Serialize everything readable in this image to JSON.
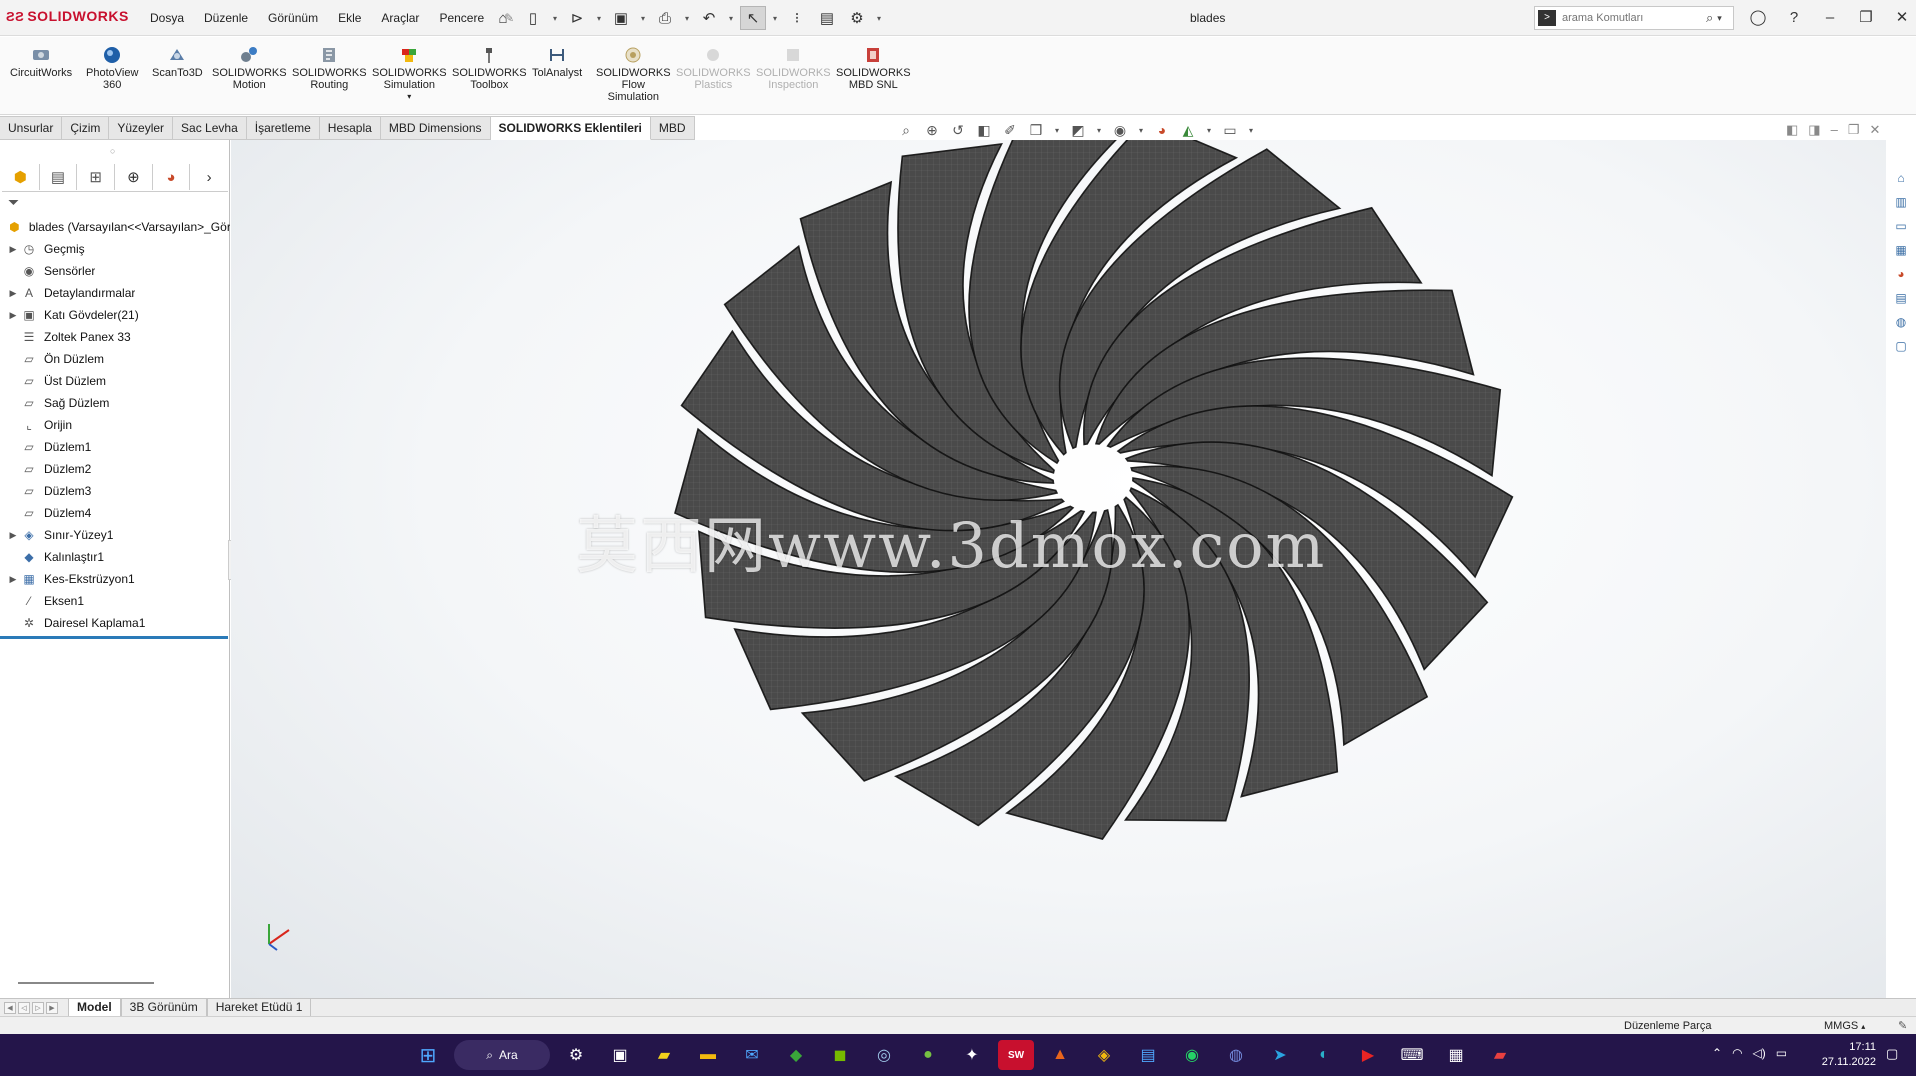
{
  "app": {
    "logo_text": "SOLIDWORKS",
    "doc_title": "blades"
  },
  "menu": [
    "Dosya",
    "Düzenle",
    "Görünüm",
    "Ekle",
    "Araçlar",
    "Pencere"
  ],
  "search": {
    "placeholder": "arama Komutları"
  },
  "ribbon": [
    {
      "label": "CircuitWorks",
      "icon": "circuitworks-icon",
      "disabled": false
    },
    {
      "label": "PhotoView\n360",
      "icon": "photoview-icon",
      "disabled": false
    },
    {
      "label": "ScanTo3D",
      "icon": "scanto3d-icon",
      "disabled": false
    },
    {
      "label": "SOLIDWORKS\nMotion",
      "icon": "motion-icon",
      "disabled": false
    },
    {
      "label": "SOLIDWORKS\nRouting",
      "icon": "routing-icon",
      "disabled": false
    },
    {
      "label": "SOLIDWORKS\nSimulation",
      "icon": "simulation-icon",
      "disabled": false
    },
    {
      "label": "SOLIDWORKS\nToolbox",
      "icon": "toolbox-icon",
      "disabled": false
    },
    {
      "label": "TolAnalyst",
      "icon": "tolanalyst-icon",
      "disabled": false
    },
    {
      "label": "SOLIDWORKS\nFlow\nSimulation",
      "icon": "flow-simulation-icon",
      "disabled": false
    },
    {
      "label": "SOLIDWORKS\nPlastics",
      "icon": "plastics-icon",
      "disabled": true
    },
    {
      "label": "SOLIDWORKS\nInspection",
      "icon": "inspection-icon",
      "disabled": true
    },
    {
      "label": "SOLIDWORKS\nMBD SNL",
      "icon": "mbd-snl-icon",
      "disabled": false
    }
  ],
  "tabs": [
    {
      "label": "Unsurlar",
      "active": false
    },
    {
      "label": "Çizim",
      "active": false
    },
    {
      "label": "Yüzeyler",
      "active": false
    },
    {
      "label": "Sac Levha",
      "active": false
    },
    {
      "label": "İşaretleme",
      "active": false
    },
    {
      "label": "Hesapla",
      "active": false
    },
    {
      "label": "MBD Dimensions",
      "active": false
    },
    {
      "label": "SOLIDWORKS Eklentileri",
      "active": true
    },
    {
      "label": "MBD",
      "active": false
    }
  ],
  "tree": {
    "root": "blades  (Varsayılan<<Varsayılan>_Görün",
    "items": [
      {
        "label": "Geçmiş",
        "expandable": true,
        "icon": "history-icon"
      },
      {
        "label": "Sensörler",
        "expandable": false,
        "icon": "sensor-icon"
      },
      {
        "label": "Detaylandırmalar",
        "expandable": true,
        "icon": "annotation-icon"
      },
      {
        "label": "Katı Gövdeler(21)",
        "expandable": true,
        "icon": "solid-bodies-icon"
      },
      {
        "label": "Zoltek Panex 33",
        "expandable": false,
        "icon": "material-icon"
      },
      {
        "label": "Ön Düzlem",
        "expandable": false,
        "icon": "plane-icon"
      },
      {
        "label": "Üst Düzlem",
        "expandable": false,
        "icon": "plane-icon"
      },
      {
        "label": "Sağ Düzlem",
        "expandable": false,
        "icon": "plane-icon"
      },
      {
        "label": "Orijin",
        "expandable": false,
        "icon": "origin-icon"
      },
      {
        "label": "Düzlem1",
        "expandable": false,
        "icon": "plane-icon"
      },
      {
        "label": "Düzlem2",
        "expandable": false,
        "icon": "plane-icon"
      },
      {
        "label": "Düzlem3",
        "expandable": false,
        "icon": "plane-icon"
      },
      {
        "label": "Düzlem4",
        "expandable": false,
        "icon": "plane-icon"
      },
      {
        "label": "Sınır-Yüzey1",
        "expandable": true,
        "icon": "boundary-surface-icon"
      },
      {
        "label": "Kalınlaştır1",
        "expandable": false,
        "icon": "thicken-icon"
      },
      {
        "label": "Kes-Ekstrüzyon1",
        "expandable": true,
        "icon": "cut-extrude-icon"
      },
      {
        "label": "Eksen1",
        "expandable": false,
        "icon": "axis-icon"
      },
      {
        "label": "Dairesel Kaplama1",
        "expandable": false,
        "icon": "circular-pattern-icon"
      }
    ]
  },
  "viewport": {
    "watermark": "莫西网www.3dmox.com",
    "blade_count": 21
  },
  "bottom_tabs": [
    {
      "label": "Model",
      "active": true
    },
    {
      "label": "3B Görünüm",
      "active": false
    },
    {
      "label": "Hareket Etüdü 1",
      "active": false
    }
  ],
  "status": {
    "mode": "Düzenleme Parça",
    "units": "MMGS"
  },
  "taskbar": {
    "search_label": "Ara",
    "time": "17:11",
    "date": "27.11.2022"
  },
  "colors": {
    "brand": "#c8102e",
    "taskbar": "#24154a",
    "blade_fill": "#4a4a4a"
  }
}
